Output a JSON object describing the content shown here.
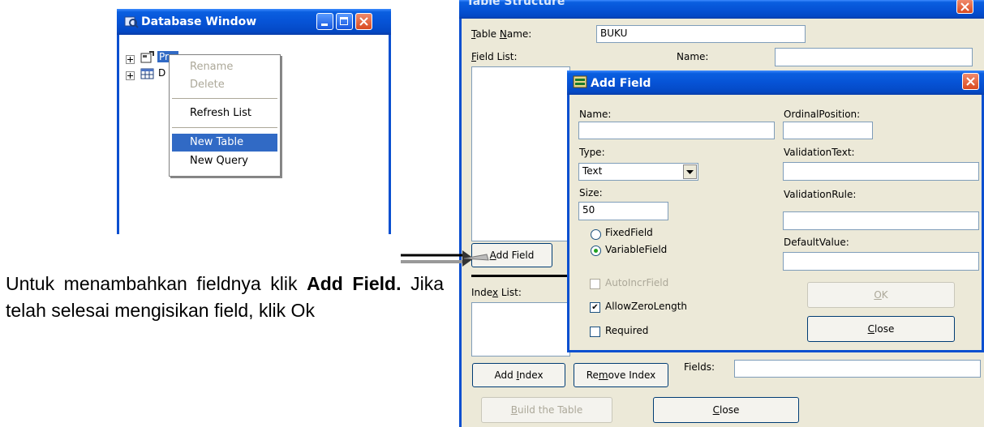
{
  "db_window": {
    "title": "Database Window",
    "tree_items": [
      "Properties",
      "D"
    ],
    "context_menu": [
      {
        "label": "Rename",
        "state": "disabled"
      },
      {
        "label": "Delete",
        "state": "disabled"
      },
      {
        "label": "Refresh List",
        "state": "normal"
      },
      {
        "label": "New Table",
        "state": "selected"
      },
      {
        "label": "New Query",
        "state": "normal"
      }
    ]
  },
  "table_structure": {
    "title": "Table Structure",
    "table_name_label": "Table Name:",
    "table_name_value": "BUKU",
    "field_list_label": "Field List:",
    "name_label": "Name:",
    "add_field_button": "Add Field",
    "index_list_label": "Index List:",
    "fields_label": "Fields:",
    "add_index_button": "Add Index",
    "remove_index_button": "Remove Index",
    "build_table_button": "Build the Table",
    "close_button": "Close"
  },
  "add_field": {
    "title": "Add Field",
    "name_label": "Name:",
    "name_value": "",
    "type_label": "Type:",
    "type_value": "Text",
    "size_label": "Size:",
    "size_value": "50",
    "fixed_field_label": "FixedField",
    "variable_field_label": "VariableField",
    "autoincr_label": "AutoIncrField",
    "allow_zero_length_label": "AllowZeroLength",
    "required_label": "Required",
    "ordinal_position_label": "OrdinalPosition:",
    "validation_text_label": "ValidationText:",
    "validation_rule_label": "ValidationRule:",
    "default_value_label": "DefaultValue:",
    "ok_button": "OK",
    "close_button": "Close"
  },
  "caption": {
    "text1": "Untuk menambahkan fieldnya klik ",
    "bold": "Add Field.",
    "text2": " Jika telah selesai mengisikan field, klik Ok"
  },
  "colors": {
    "xp_title_blue": "#0653d6",
    "selection_blue": "#316ac5",
    "dialog_gray": "#ece9d8",
    "close_red": "#d94a20"
  }
}
